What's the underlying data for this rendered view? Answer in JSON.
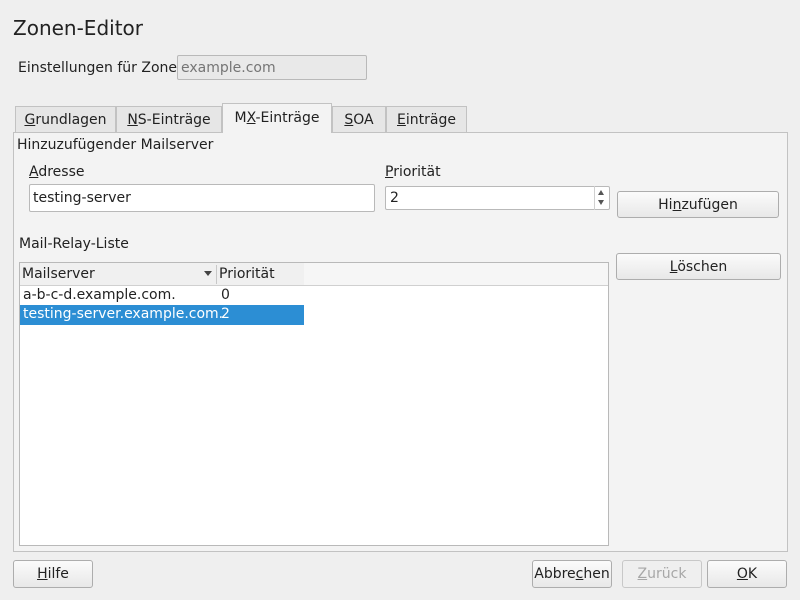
{
  "window": {
    "title": "Zonen-Editor",
    "corner_icon": "moon-icon"
  },
  "zone": {
    "label": "Einstellungen für Zone",
    "placeholder": "example.com",
    "value": ""
  },
  "tabs": [
    {
      "pre": "",
      "mn": "G",
      "post": "rundlagen",
      "active": false
    },
    {
      "pre": "",
      "mn": "N",
      "post": "S-Einträge",
      "active": false
    },
    {
      "pre": "M",
      "mn": "X",
      "post": "-Einträge",
      "active": true
    },
    {
      "pre": "",
      "mn": "S",
      "post": "OA",
      "active": false
    },
    {
      "pre": "",
      "mn": "E",
      "post": "inträge",
      "active": false
    }
  ],
  "mx": {
    "section_title": "Hinzuzufügender Mailserver",
    "address_label": {
      "pre": "",
      "mn": "A",
      "post": "dresse"
    },
    "address_value": "testing-server",
    "priority_label": {
      "pre": "",
      "mn": "P",
      "post": "riorität"
    },
    "priority_value": "2",
    "add_button": {
      "pre": "Hi",
      "mn": "n",
      "post": "zufügen"
    },
    "relay_title": "Mail-Relay-Liste",
    "delete_button": {
      "pre": "",
      "mn": "L",
      "post": "öschen"
    }
  },
  "relay_list": {
    "columns": [
      "Mailserver",
      "Priorität"
    ],
    "rows": [
      {
        "server": "a-b-c-d.example.com.",
        "priority": "0",
        "selected": false
      },
      {
        "server": "testing-server.example.com.",
        "priority": "2",
        "selected": true
      }
    ]
  },
  "footer": {
    "help": {
      "pre": "",
      "mn": "H",
      "post": "ilfe"
    },
    "cancel": {
      "pre": "Abbre",
      "mn": "c",
      "post": "hen"
    },
    "back": {
      "pre": "",
      "mn": "Z",
      "post": "urück"
    },
    "ok": {
      "pre": "",
      "mn": "O",
      "post": "K"
    }
  },
  "colors": {
    "selection": "#2c8ed4",
    "background": "#efefef",
    "panel": "#f3f3f3"
  }
}
